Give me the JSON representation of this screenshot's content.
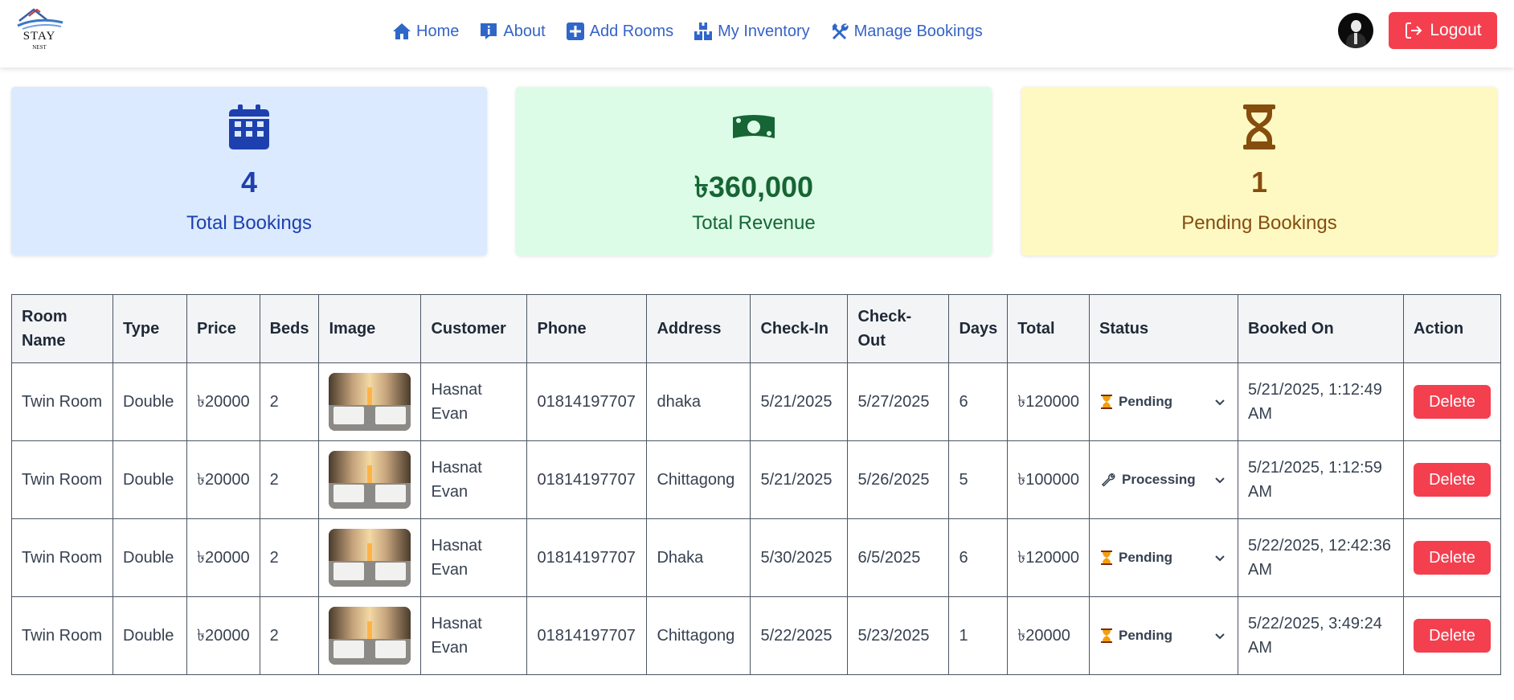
{
  "brand": {
    "name": "STAY",
    "sub": "NEST"
  },
  "nav": [
    {
      "label": "Home",
      "icon": "home-icon"
    },
    {
      "label": "About",
      "icon": "info-icon"
    },
    {
      "label": "Add Rooms",
      "icon": "plus-square-icon"
    },
    {
      "label": "My Inventory",
      "icon": "boxes-icon"
    },
    {
      "label": "Manage Bookings",
      "icon": "tools-icon"
    }
  ],
  "logout_label": "Logout",
  "stats": {
    "bookings": {
      "value": "4",
      "label": "Total Bookings",
      "icon": "calendar-icon",
      "color": "#1e40af",
      "bg": "#dbeafe"
    },
    "revenue": {
      "value": "৳360,000",
      "label": "Total Revenue",
      "icon": "money-icon",
      "color": "#166534",
      "bg": "#dcfce7"
    },
    "pending": {
      "value": "1",
      "label": "Pending Bookings",
      "icon": "hourglass-icon",
      "color": "#854d0e",
      "bg": "#fef9c3"
    }
  },
  "table": {
    "headers": [
      "Room Name",
      "Type",
      "Price",
      "Beds",
      "Image",
      "Customer",
      "Phone",
      "Address",
      "Check-In",
      "Check-Out",
      "Days",
      "Total",
      "Status",
      "Booked On",
      "Action"
    ],
    "rows": [
      {
        "room": "Twin Room",
        "type": "Double",
        "price": "৳20000",
        "beds": "2",
        "customer": "Hasnat Evan",
        "phone": "01814197707",
        "address": "dhaka",
        "checkin": "5/21/2025",
        "checkout": "5/27/2025",
        "days": "6",
        "total": "৳120000",
        "status": "Pending",
        "status_icon": "hourglass-icon",
        "booked": "5/21/2025, 1:12:49 AM",
        "action": "Delete"
      },
      {
        "room": "Twin Room",
        "type": "Double",
        "price": "৳20000",
        "beds": "2",
        "customer": "Hasnat Evan",
        "phone": "01814197707",
        "address": "Chittagong",
        "checkin": "5/21/2025",
        "checkout": "5/26/2025",
        "days": "5",
        "total": "৳100000",
        "status": "Processing",
        "status_icon": "wrench-icon",
        "booked": "5/21/2025, 1:12:59 AM",
        "action": "Delete"
      },
      {
        "room": "Twin Room",
        "type": "Double",
        "price": "৳20000",
        "beds": "2",
        "customer": "Hasnat Evan",
        "phone": "01814197707",
        "address": "Dhaka",
        "checkin": "5/30/2025",
        "checkout": "6/5/2025",
        "days": "6",
        "total": "৳120000",
        "status": "Pending",
        "status_icon": "hourglass-icon",
        "booked": "5/22/2025, 12:42:36 AM",
        "action": "Delete"
      },
      {
        "room": "Twin Room",
        "type": "Double",
        "price": "৳20000",
        "beds": "2",
        "customer": "Hasnat Evan",
        "phone": "01814197707",
        "address": "Chittagong",
        "checkin": "5/22/2025",
        "checkout": "5/23/2025",
        "days": "1",
        "total": "৳20000",
        "status": "Pending",
        "status_icon": "hourglass-icon",
        "booked": "5/22/2025, 3:49:24 AM",
        "action": "Delete"
      }
    ]
  }
}
